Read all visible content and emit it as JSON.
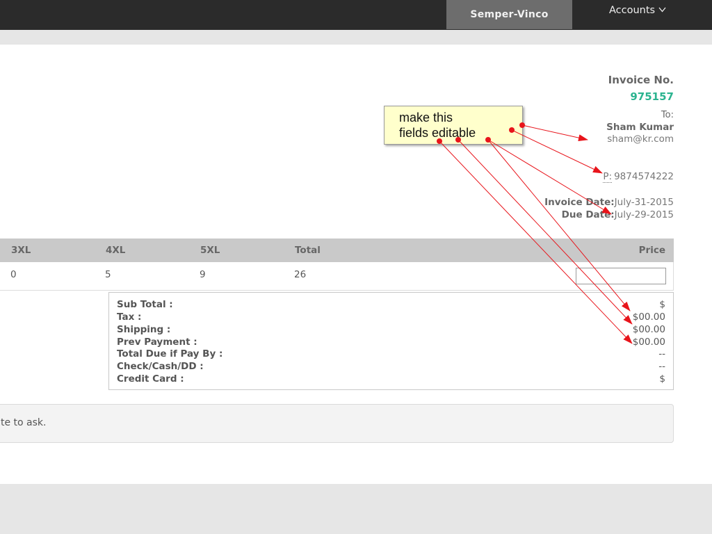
{
  "navbar": {
    "brand": "Semper-Vinco",
    "accounts_label": "Accounts"
  },
  "invoice": {
    "label": "Invoice No.",
    "number": "975157",
    "to_label": "To:",
    "customer_name": "Sham Kumar",
    "customer_email": "sham@kr.com",
    "phone_abbr": "P:",
    "phone": "9874574222",
    "invoice_date_label": "Invoice Date:",
    "invoice_date": "July-31-2015",
    "due_date_label": "Due Date:",
    "due_date": "July-29-2015"
  },
  "table": {
    "headers": [
      "3XL",
      "4XL",
      "5XL",
      "Total",
      "Price"
    ],
    "row": [
      "0",
      "5",
      "9",
      "26"
    ]
  },
  "totals": [
    {
      "label": "Sub Total :",
      "value": "$"
    },
    {
      "label": "Tax :",
      "value": "$00.00"
    },
    {
      "label": "Shipping :",
      "value": "$00.00"
    },
    {
      "label": "Prev Payment :",
      "value": "$00.00"
    },
    {
      "label": "Total Due if Pay By :",
      "value": "--"
    },
    {
      "label": "Check/Cash/DD :",
      "value": "--"
    },
    {
      "label": "Credit Card :",
      "value": "$"
    }
  ],
  "note": {
    "text": "te to ask."
  },
  "annotation": {
    "line1": "make this",
    "line2": "fields editable"
  },
  "colors": {
    "navbar_bg": "#2b2b2b",
    "brand_bg": "#6d6d6d",
    "invoice_number": "#2bb38f",
    "annotation_arrow": "#e8141b",
    "sticky_bg": "#ffffcc"
  }
}
